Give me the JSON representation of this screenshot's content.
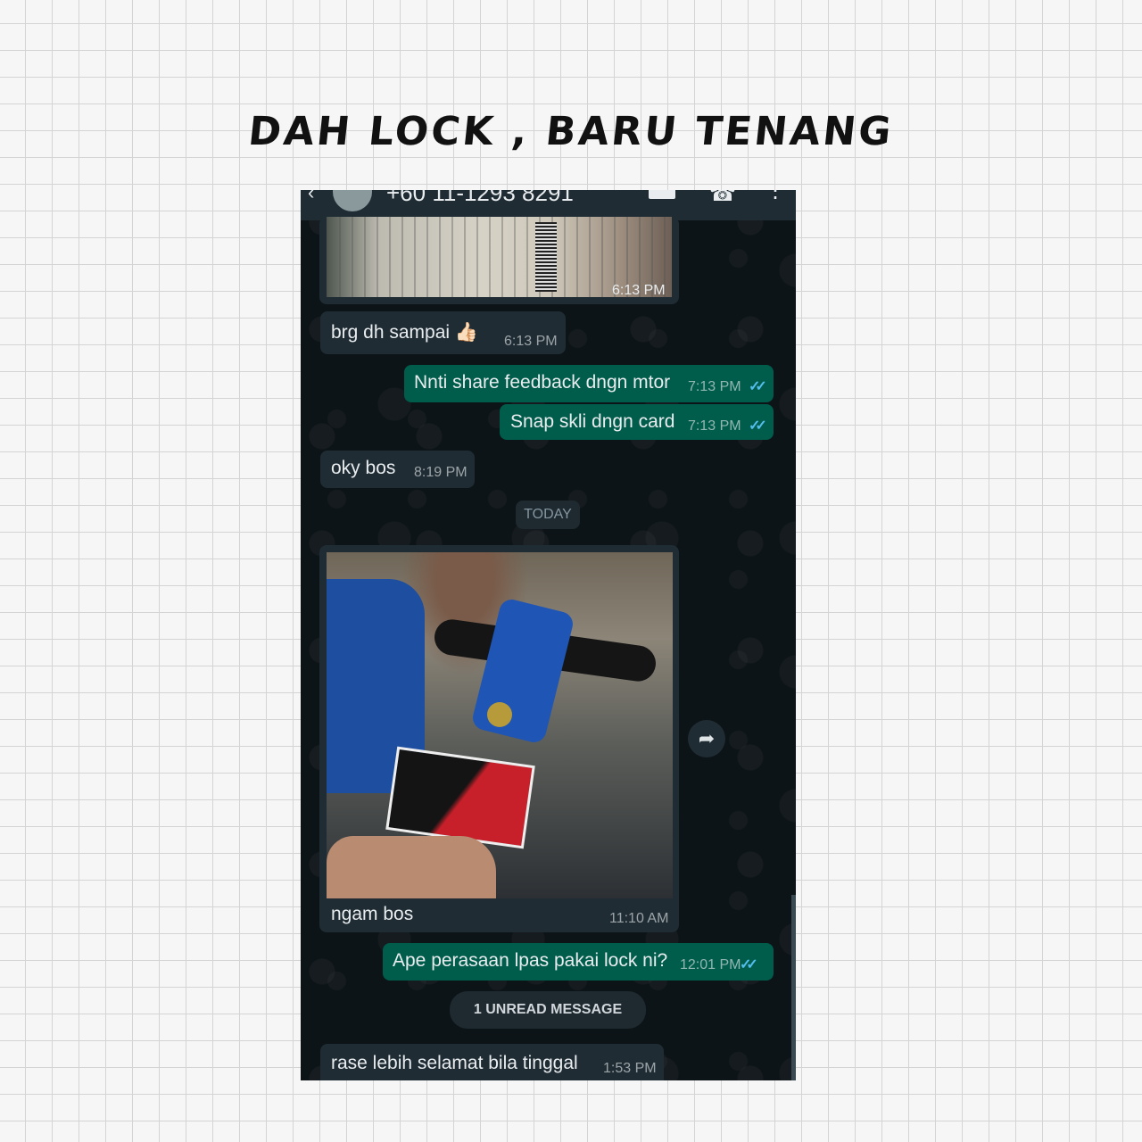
{
  "header": {
    "title": "DAH LOCK , BARU  TENANG"
  },
  "chat": {
    "contact_number": "+60 11-1293 8291",
    "icons": {
      "back": "back-arrow-icon",
      "video": "video-call-icon",
      "call": "phone-call-icon",
      "menu": "more-vert-icon"
    },
    "messages": [
      {
        "type": "image",
        "direction": "in",
        "time": "6:13 PM"
      },
      {
        "type": "text",
        "direction": "in",
        "text": "brg dh sampai 👍🏻",
        "time": "6:13 PM"
      },
      {
        "type": "text",
        "direction": "out",
        "text": "Nnti share feedback dngn mtor",
        "time": "7:13 PM",
        "status": "read"
      },
      {
        "type": "text",
        "direction": "out",
        "text": "Snap skli dngn card",
        "time": "7:13 PM",
        "status": "read"
      },
      {
        "type": "text",
        "direction": "in",
        "text": "oky bos",
        "time": "8:19 PM"
      },
      {
        "type": "image",
        "direction": "in",
        "caption": "ngam bos",
        "time": "11:10 AM"
      },
      {
        "type": "text",
        "direction": "out",
        "text": "Ape perasaan lpas pakai lock ni?",
        "time": "12:01 PM",
        "status": "read"
      },
      {
        "type": "text",
        "direction": "in",
        "text": "rase lebih selamat bila tinggal",
        "time": "1:53 PM"
      }
    ],
    "date_separator": "TODAY",
    "unread_banner": "1 UNREAD MESSAGE",
    "read_ticks": "✓✓",
    "colors": {
      "incoming": "#1f2c34",
      "outgoing": "#005c4b",
      "tick": "#53bdeb",
      "background": "#0d1418"
    }
  }
}
